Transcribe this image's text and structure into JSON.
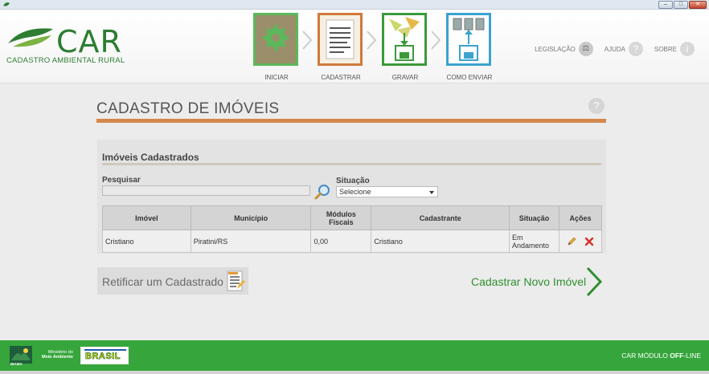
{
  "window": {
    "minimize": "–",
    "maximize": "□",
    "close": "✕"
  },
  "logo": {
    "name": "CAR",
    "subtitle": "CADASTRO AMBIENTAL RURAL"
  },
  "steps": [
    {
      "label": "INICIAR",
      "color": "#5bb85c"
    },
    {
      "label": "CADASTRAR",
      "color": "#d07a3b"
    },
    {
      "label": "GRAVAR",
      "color": "#3a9a3a"
    },
    {
      "label": "COMO ENVIAR",
      "color": "#3ba3cf"
    }
  ],
  "topnav": {
    "legislacao": "LEGISLAÇÃO",
    "ajuda": "AJUDA",
    "sobre": "SOBRE",
    "help_glyph": "?",
    "info_glyph": "i",
    "law_glyph": "⚖"
  },
  "page": {
    "title": "CADASTRO DE IMÓVEIS",
    "help_glyph": "?"
  },
  "panel": {
    "title": "Imóveis Cadastrados",
    "search_label": "Pesquisar",
    "search_value": "",
    "situacao_label": "Situação",
    "situacao_value": "Selecione"
  },
  "table": {
    "headers": [
      "Imóvel",
      "Município",
      "Módulos Fiscais",
      "Cadastrante",
      "Situação",
      "Ações"
    ],
    "rows": [
      {
        "imovel": "Cristiano",
        "municipio": "Piratini/RS",
        "modulos": "0,00",
        "cadastrante": "Cristiano",
        "situacao": "Em Andamento"
      }
    ]
  },
  "actions": {
    "retificar": "Retificar um Cadastrado",
    "novo": "Cadastrar Novo Imóvel"
  },
  "footer": {
    "ibama": "IBAMA",
    "ministerio": "Ministério do",
    "meio_ambiente": "Meio Ambiente",
    "brasil": "BRASIL",
    "modulo_prefix": "CAR  MÓDULO ",
    "modulo_suffix": "OFF",
    "modulo_end": "-LINE"
  }
}
